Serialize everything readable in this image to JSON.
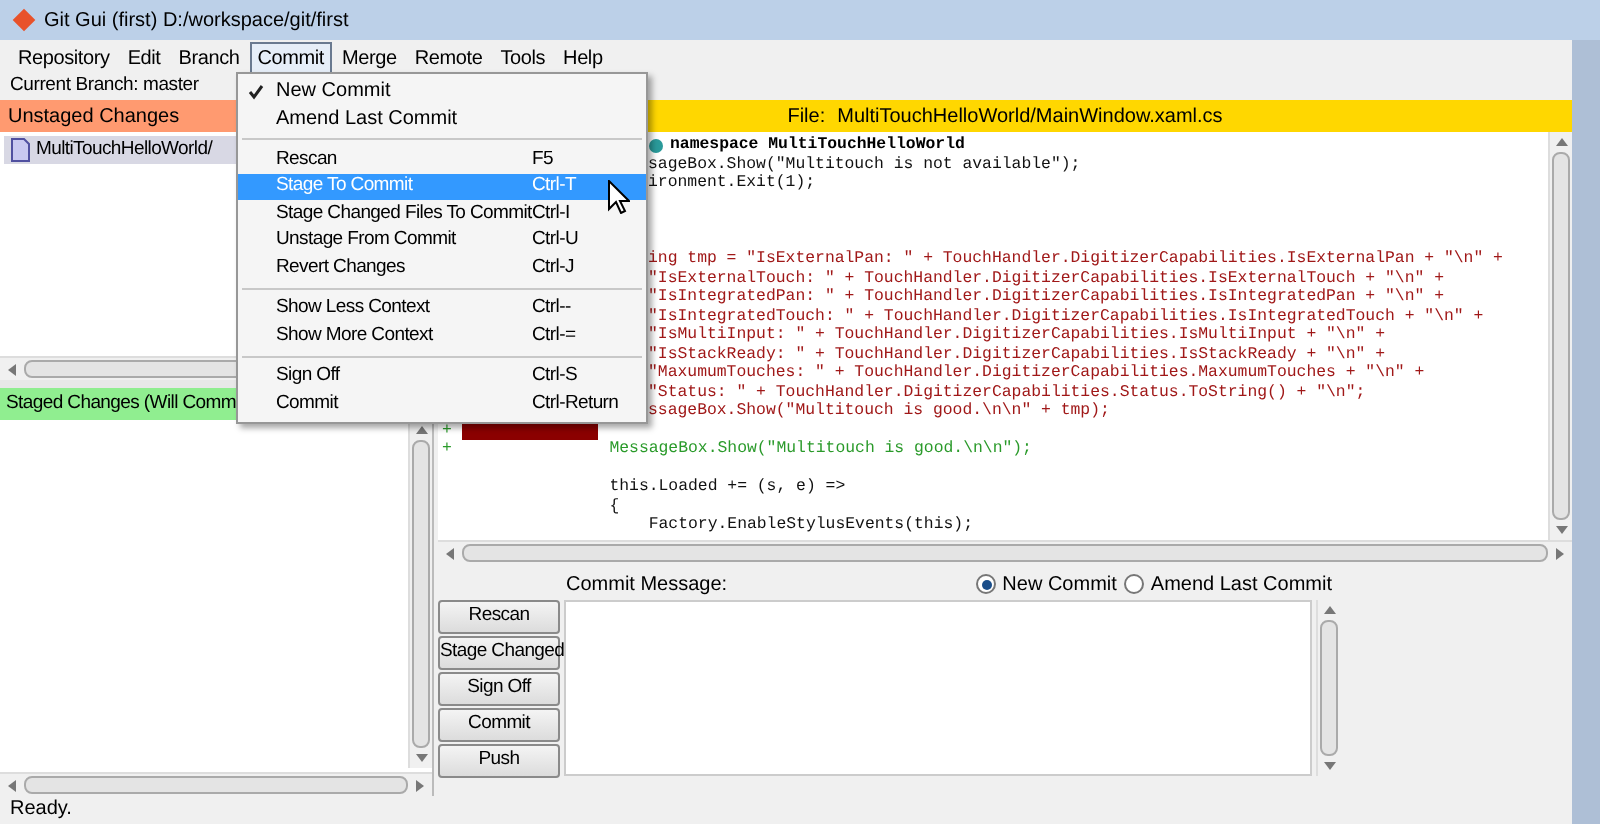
{
  "window": {
    "title": "Git Gui (first) D:/workspace/git/first"
  },
  "menu_bar": [
    {
      "label": "Repository",
      "selected": false
    },
    {
      "label": "Edit",
      "selected": false
    },
    {
      "label": "Branch",
      "selected": false
    },
    {
      "label": "Commit",
      "selected": true
    },
    {
      "label": "Merge",
      "selected": false
    },
    {
      "label": "Remote",
      "selected": false
    },
    {
      "label": "Tools",
      "selected": false
    },
    {
      "label": "Help",
      "selected": false
    }
  ],
  "commit_menu": [
    {
      "kind": "radio",
      "label": "New Commit",
      "checked": true,
      "selected": false
    },
    {
      "kind": "radio",
      "label": "Amend Last Commit",
      "checked": false,
      "selected": false
    },
    {
      "kind": "separator"
    },
    {
      "kind": "item",
      "label": "Rescan",
      "shortcut": "F5",
      "selected": false
    },
    {
      "kind": "item",
      "label": "Stage To Commit",
      "shortcut": "Ctrl-T",
      "selected": true
    },
    {
      "kind": "item",
      "label": "Stage Changed Files To Commit",
      "shortcut": "Ctrl-I",
      "selected": false
    },
    {
      "kind": "item",
      "label": "Unstage From Commit",
      "shortcut": "Ctrl-U",
      "selected": false
    },
    {
      "kind": "item",
      "label": "Revert Changes",
      "shortcut": "Ctrl-J",
      "selected": false
    },
    {
      "kind": "separator"
    },
    {
      "kind": "item",
      "label": "Show Less Context",
      "shortcut": "Ctrl--",
      "selected": false
    },
    {
      "kind": "item",
      "label": "Show More Context",
      "shortcut": "Ctrl-=",
      "selected": false
    },
    {
      "kind": "separator"
    },
    {
      "kind": "item",
      "label": "Sign Off",
      "shortcut": "Ctrl-S",
      "selected": false
    },
    {
      "kind": "item",
      "label": "Commit",
      "shortcut": "Ctrl-Return",
      "selected": false
    }
  ],
  "current_branch": "Current Branch: master",
  "unstaged": {
    "title": "Unstaged Changes",
    "files": [
      {
        "name": "MultiTouchHelloWorld/",
        "selected": true
      }
    ]
  },
  "staged": {
    "title": "Staged Changes (Will Comm"
  },
  "diff": {
    "file_label": "File:",
    "file_path": "MultiTouchHelloWorld/MainWindow.xaml.cs",
    "lines": [
      {
        "kind": "header",
        "text": "namespace MultiTouchHelloWorld",
        "clipped": true
      },
      {
        "kind": "context",
        "text": "sageBox.Show(\"Multitouch is not available\");",
        "clipped": true
      },
      {
        "kind": "context",
        "text": "ironment.Exit(1);",
        "clipped": true
      },
      {
        "kind": "blank"
      },
      {
        "kind": "blank"
      },
      {
        "kind": "blank"
      },
      {
        "kind": "removed",
        "text": "ing tmp = \"IsExternalPan: \" + TouchHandler.DigitizerCapabilities.IsExternalPan + \"\\n\" +",
        "clipped": true
      },
      {
        "kind": "removed",
        "text": "\"IsExternalTouch: \" + TouchHandler.DigitizerCapabilities.IsExternalTouch + \"\\n\" +",
        "clipped": true
      },
      {
        "kind": "removed",
        "text": "\"IsIntegratedPan: \" + TouchHandler.DigitizerCapabilities.IsIntegratedPan + \"\\n\" +",
        "clipped": true
      },
      {
        "kind": "removed",
        "text": "\"IsIntegratedTouch: \" + TouchHandler.DigitizerCapabilities.IsIntegratedTouch + \"\\n\" +",
        "clipped": true
      },
      {
        "kind": "removed",
        "text": "\"IsMultiInput: \" + TouchHandler.DigitizerCapabilities.IsMultiInput + \"\\n\" +",
        "clipped": true
      },
      {
        "kind": "removed",
        "text": "\"IsStackReady: \" + TouchHandler.DigitizerCapabilities.IsStackReady + \"\\n\" +",
        "clipped": true
      },
      {
        "kind": "removed",
        "text": "\"MaxumumTouches: \" + TouchHandler.DigitizerCapabilities.MaxumumTouches + \"\\n\" +",
        "clipped": true
      },
      {
        "kind": "removed",
        "text": "\"Status: \" + TouchHandler.DigitizerCapabilities.Status.ToString() + \"\\n\";",
        "clipped": true
      },
      {
        "kind": "removed",
        "text": "ssageBox.Show(\"Multitouch is good.\\n\\n\" + tmp);",
        "clipped": true
      },
      {
        "kind": "highlight",
        "marker": "+",
        "clipped": false
      },
      {
        "kind": "added",
        "marker": "+",
        "text": "               MessageBox.Show(\"Multitouch is good.\\n\\n\");",
        "clipped": false
      },
      {
        "kind": "blank"
      },
      {
        "kind": "context",
        "text": "               this.Loaded += (s, e) =>",
        "clipped": false
      },
      {
        "kind": "context",
        "text": "               {",
        "clipped": false
      },
      {
        "kind": "context",
        "text": "                   Factory.EnableStylusEvents(this);",
        "clipped": false
      }
    ]
  },
  "commit": {
    "buttons": [
      "Rescan",
      "Stage Changed",
      "Sign Off",
      "Commit",
      "Push"
    ],
    "message_label": "Commit Message:",
    "modes": [
      {
        "label": "New Commit",
        "selected": true
      },
      {
        "label": "Amend Last Commit",
        "selected": false
      }
    ]
  },
  "status_bar": "Ready."
}
